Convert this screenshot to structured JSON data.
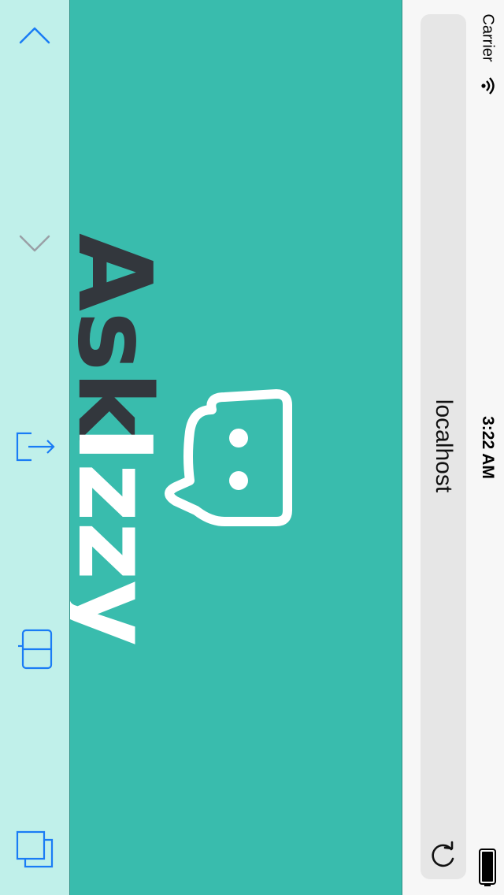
{
  "status_bar": {
    "carrier": "Carrier",
    "time": "3:22 AM",
    "icons": [
      "wifi-icon",
      "battery-icon"
    ]
  },
  "browser": {
    "url": "localhost",
    "toolbar_icons": [
      "chevron-up-icon",
      "chevron-down-icon",
      "share-icon",
      "bookmarks-icon",
      "tabs-icon",
      "reload-icon"
    ]
  },
  "page": {
    "logo_text_dark": "Ask",
    "logo_text_light": "Izzy"
  },
  "colors": {
    "page_background": "#39bcad",
    "toolbar_background": "#c0f0ea",
    "logo_dark": "#33373d",
    "logo_light": "#ffffff",
    "ios_blue": "#1a7cf5"
  }
}
